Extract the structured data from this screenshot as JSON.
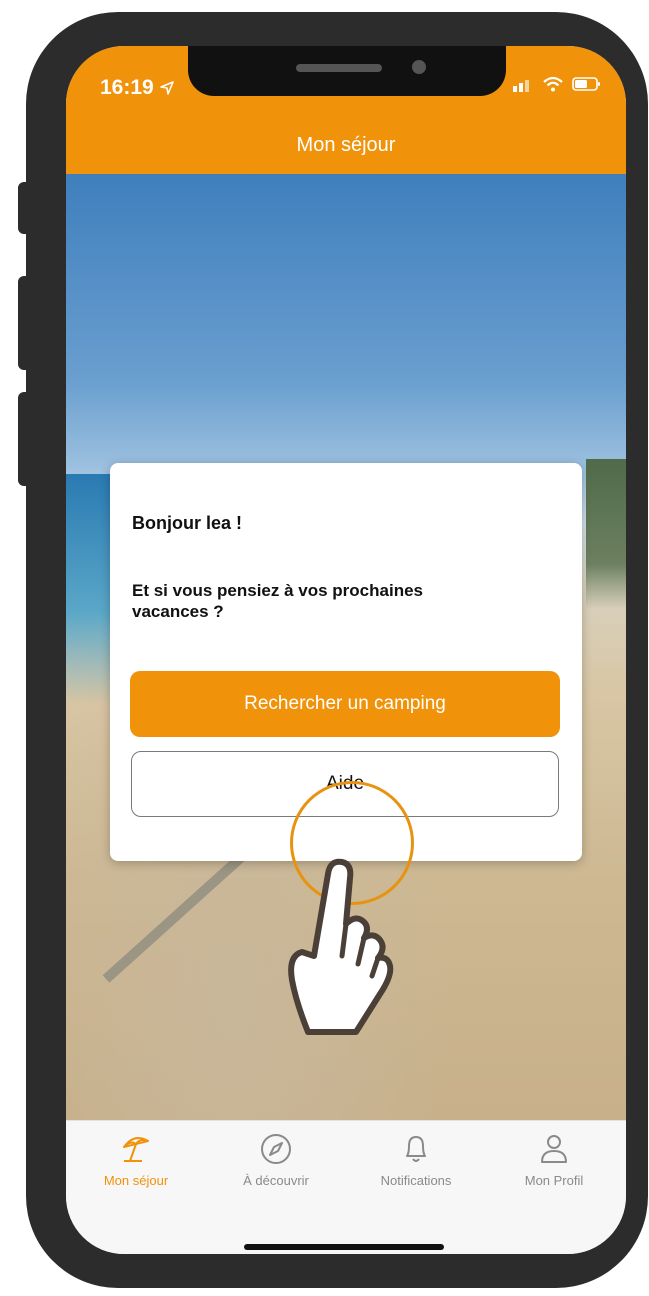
{
  "status_bar": {
    "time": "16:19",
    "icons": [
      "location-arrow-icon",
      "signal-icon",
      "wifi-icon",
      "battery-icon"
    ]
  },
  "header": {
    "title": "Mon séjour"
  },
  "colors": {
    "accent": "#f0920a",
    "background_card": "#ffffff",
    "tab_inactive": "#8a8a8a"
  },
  "card": {
    "greeting": "Bonjour lea !",
    "question": "Et si vous pensiez à vos prochaines vacances ?",
    "primary_button": "Rechercher un camping",
    "secondary_button": "Aide"
  },
  "tabbar": {
    "items": [
      {
        "label": "Mon séjour",
        "icon": "beach-umbrella-icon",
        "active": true
      },
      {
        "label": "À découvrir",
        "icon": "compass-icon",
        "active": false
      },
      {
        "label": "Notifications",
        "icon": "bell-icon",
        "active": false
      },
      {
        "label": "Mon Profil",
        "icon": "user-icon",
        "active": false
      }
    ]
  }
}
